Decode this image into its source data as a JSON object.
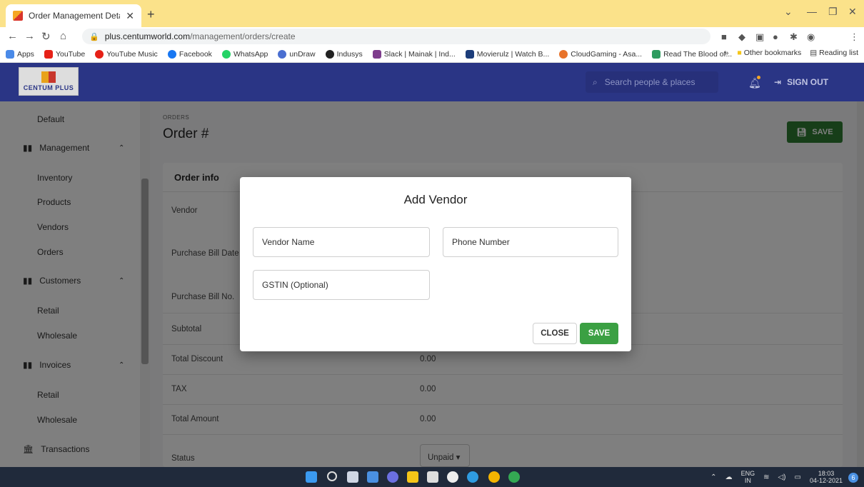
{
  "browser": {
    "tab_title": "Order Management Details",
    "url_domain": "plus.centumworld.com",
    "url_path": "/management/orders/create",
    "bookmarks": [
      "Apps",
      "YouTube",
      "YouTube Music",
      "Facebook",
      "WhatsApp",
      "unDraw",
      "Indusys",
      "Slack | Mainak | Ind...",
      "Movierulz | Watch B...",
      "CloudGaming - Asa...",
      "Read The Blood of..."
    ],
    "bookmarks_right": [
      "»",
      "Other bookmarks",
      "Reading list"
    ]
  },
  "app": {
    "logo_text": "CENTUM PLUS",
    "search_placeholder": "Search people & places",
    "sign_out": "SIGN OUT"
  },
  "sidebar": {
    "default": "Default",
    "management": "Management",
    "management_items": [
      "Inventory",
      "Products",
      "Vendors",
      "Orders"
    ],
    "customers": "Customers",
    "customers_items": [
      "Retail",
      "Wholesale"
    ],
    "invoices": "Invoices",
    "invoices_items": [
      "Retail",
      "Wholesale"
    ],
    "transactions": "Transactions"
  },
  "page": {
    "breadcrumb": "ORDERS",
    "title": "Order #",
    "save": "SAVE",
    "card_title": "Order info",
    "fields": {
      "vendor": "Vendor",
      "bill_date": "Purchase Bill Date",
      "bill_no": "Purchase Bill No.",
      "subtotal": "Subtotal",
      "total_discount": "Total Discount",
      "tax": "TAX",
      "total_amount": "Total Amount",
      "status": "Status"
    },
    "values": {
      "total_discount": "0.00",
      "tax": "0.00",
      "total_amount": "0.00",
      "status": "Unpaid"
    }
  },
  "dialog": {
    "title": "Add Vendor",
    "vendor_name": "Vendor Name",
    "phone_number": "Phone Number",
    "gstin": "GSTIN (Optional)",
    "close": "CLOSE",
    "save": "SAVE"
  },
  "taskbar": {
    "lang_top": "ENG",
    "lang_bottom": "IN",
    "time": "18:03",
    "date": "04-12-2021",
    "notifications": "6"
  },
  "colors": {
    "appbar": "#2a3585",
    "save_green": "#3ba043",
    "tab_strip": "#fbe28a"
  }
}
